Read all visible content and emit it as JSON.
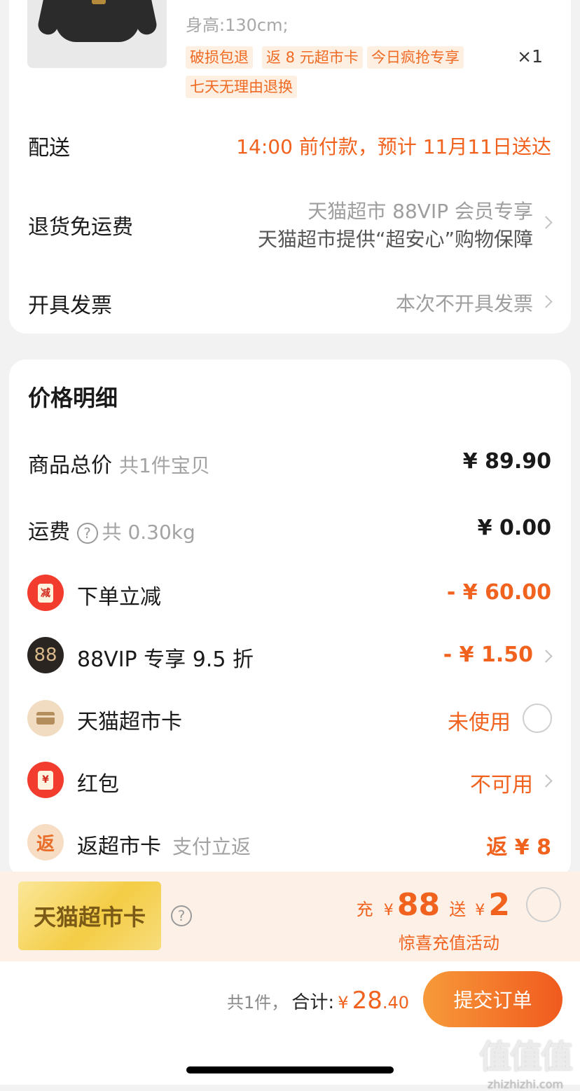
{
  "product": {
    "spec": "身高:130cm;",
    "tags": [
      "破损包退",
      "返 8 元超市卡",
      "今日疯抢专享",
      "七天无理由退换"
    ],
    "qty": "×1"
  },
  "delivery": {
    "label": "配送",
    "value": "14:00 前付款，预计 11月11日送达"
  },
  "return_shipping": {
    "label": "退货免运费",
    "line1": "天猫超市 88VIP 会员专享",
    "line2": "天猫超市提供“超安心”购物保障"
  },
  "invoice": {
    "label": "开具发票",
    "value": "本次不开具发票"
  },
  "price_detail": {
    "title": "价格明细",
    "goods_total": {
      "label": "商品总价",
      "sub": "共1件宝贝",
      "amount": "¥ 89.90"
    },
    "shipping": {
      "label": "运费",
      "help": "?",
      "sub": "共 0.30kg",
      "amount": "¥ 0.00"
    },
    "instant_discount": {
      "icon_text": "减",
      "label": "下单立减",
      "amount": "- ¥ 60.00"
    },
    "vip_discount": {
      "icon_text": "88",
      "label": "88VIP 专享 9.5 折",
      "amount": "- ¥ 1.50"
    },
    "market_card": {
      "label": "天猫超市卡",
      "status": "未使用"
    },
    "red_packet": {
      "icon_text": "¥",
      "label": "红包",
      "status": "不可用"
    },
    "cashback": {
      "icon_text": "返",
      "label": "返超市卡",
      "sub": "支付立返",
      "amount": "返 ¥ 8"
    }
  },
  "promo": {
    "card_text": "天猫超市卡",
    "help": "?",
    "charge_label": "充",
    "charge_currency": "¥",
    "charge_amount": "88",
    "bonus_label": "送",
    "bonus_currency": "¥",
    "bonus_amount": "2",
    "subtitle": "惊喜充值活动"
  },
  "footer": {
    "count_text": "共1件，",
    "total_label": "合计:",
    "currency": "¥",
    "total_int": "28",
    "total_dec": ".40",
    "submit_label": "提交订单"
  },
  "watermark": {
    "big": "值值值",
    "small": "zhizhizhi.com"
  },
  "colors": {
    "accent": "#f0621e",
    "tag_bg": "#fdf0e3",
    "promo_bg": "#fdf1e7"
  }
}
